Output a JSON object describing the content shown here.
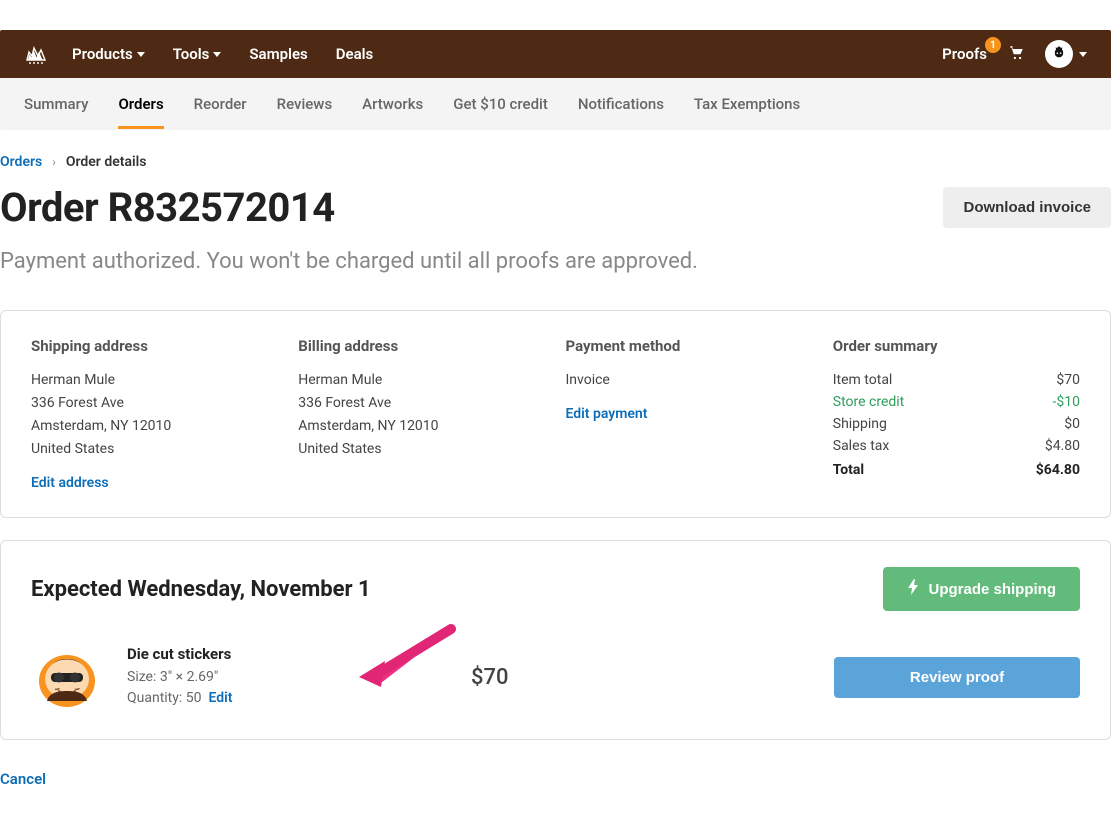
{
  "topnav": {
    "products": "Products",
    "tools": "Tools",
    "samples": "Samples",
    "deals": "Deals",
    "proofs": "Proofs",
    "proofs_badge": "1"
  },
  "subnav": {
    "summary": "Summary",
    "orders": "Orders",
    "reorder": "Reorder",
    "reviews": "Reviews",
    "artworks": "Artworks",
    "credit": "Get $10 credit",
    "notifications": "Notifications",
    "tax": "Tax Exemptions"
  },
  "breadcrumb": {
    "orders": "Orders",
    "sep": "›",
    "current": "Order details"
  },
  "title": "Order R832572014",
  "download_label": "Download invoice",
  "subtitle": "Payment authorized. You won't be charged until all proofs are approved.",
  "shipping": {
    "heading": "Shipping address",
    "name": "Herman Mule",
    "street": "336 Forest Ave",
    "city": "Amsterdam, NY 12010",
    "country": "United States",
    "edit": "Edit address"
  },
  "billing": {
    "heading": "Billing address",
    "name": "Herman Mule",
    "street": "336 Forest Ave",
    "city": "Amsterdam, NY 12010",
    "country": "United States"
  },
  "payment": {
    "heading": "Payment method",
    "text": "Invoice",
    "edit": "Edit payment"
  },
  "summary": {
    "heading": "Order summary",
    "item_total_label": "Item total",
    "item_total_value": "$70",
    "credit_label": "Store credit",
    "credit_value": "-$10",
    "shipping_label": "Shipping",
    "shipping_value": "$0",
    "tax_label": "Sales tax",
    "tax_value": "$4.80",
    "total_label": "Total",
    "total_value": "$64.80"
  },
  "shipment": {
    "expected_prefix": "Expected ",
    "expected_date": "Wednesday, November 1",
    "upgrade": "Upgrade shipping",
    "product_name": "Die cut stickers",
    "size": "Size: 3″ × 2.69″",
    "qty_prefix": "Quantity: ",
    "qty_value": "50",
    "edit": "Edit",
    "price": "$70",
    "review": "Review proof"
  },
  "cancel": "Cancel"
}
